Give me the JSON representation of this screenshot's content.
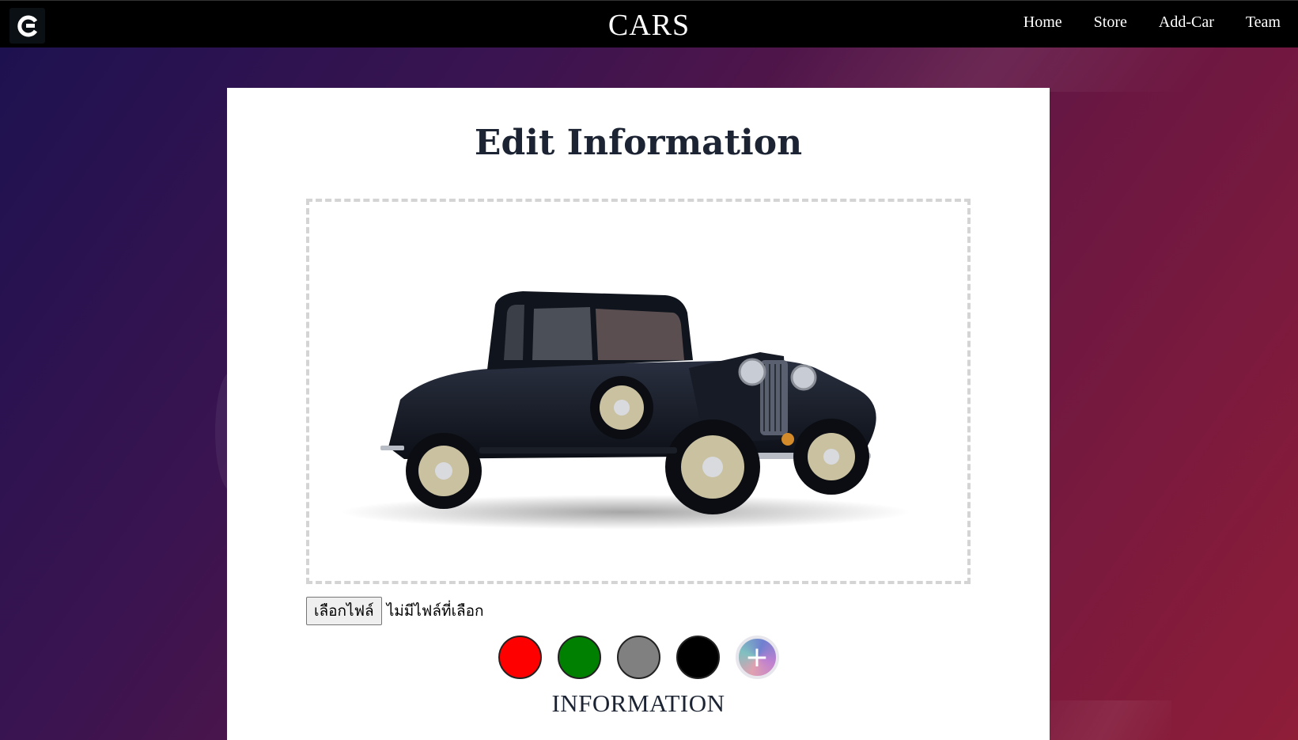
{
  "navbar": {
    "logo": "logo-icon",
    "brand": "CARS",
    "links": [
      "Home",
      "Store",
      "Add-Car",
      "Team"
    ]
  },
  "form": {
    "title": "Edit Information",
    "image_preview": "vintage-black-coupe-car",
    "file_button": "เลือกไฟล์",
    "file_status": "ไม่มีไฟล์ที่เลือก",
    "colors": [
      "#ff0000",
      "#008000",
      "#808080",
      "#000000"
    ],
    "add_color_icon": "plus-icon",
    "add_color_label": "+",
    "section_title": "INFORMATION"
  }
}
